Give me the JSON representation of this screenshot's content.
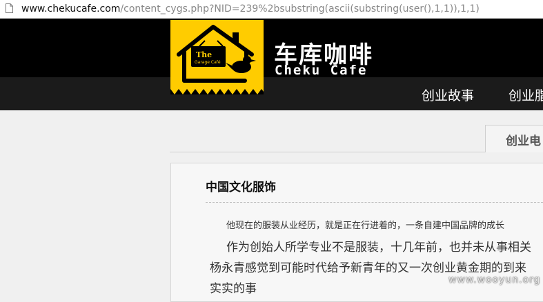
{
  "browser": {
    "url_host": "www.chekucafe.com",
    "url_path": "/content_cygs.php?NID=239%2bsubstring(ascii(substring(user(),1,1)),1,1)"
  },
  "header": {
    "logo_the": "The",
    "logo_sub": "Garage Café",
    "brand_cn": "车库咖啡",
    "brand_en": "Cheku Cafe",
    "nav": [
      "创业故事",
      "创业脂"
    ]
  },
  "tabs": [
    {
      "label": "创业电"
    }
  ],
  "article": {
    "title": "中国文化服饰",
    "intro": "他现在的服装从业经历，就是正在行进着的，一条自建中国品牌的成长",
    "line1": "作为创始人所学专业不是服装，十几年前，也并未从事相关",
    "line2": "杨永青感觉到可能时代给予新青年的又一次创业黄金期的到来",
    "line3": "实实的事"
  },
  "watermark": "www.wooyun.org",
  "colors": {
    "logo_yellow": "#ffcc00",
    "header_black": "#000000",
    "nav_bar": "#1b1b1b"
  }
}
